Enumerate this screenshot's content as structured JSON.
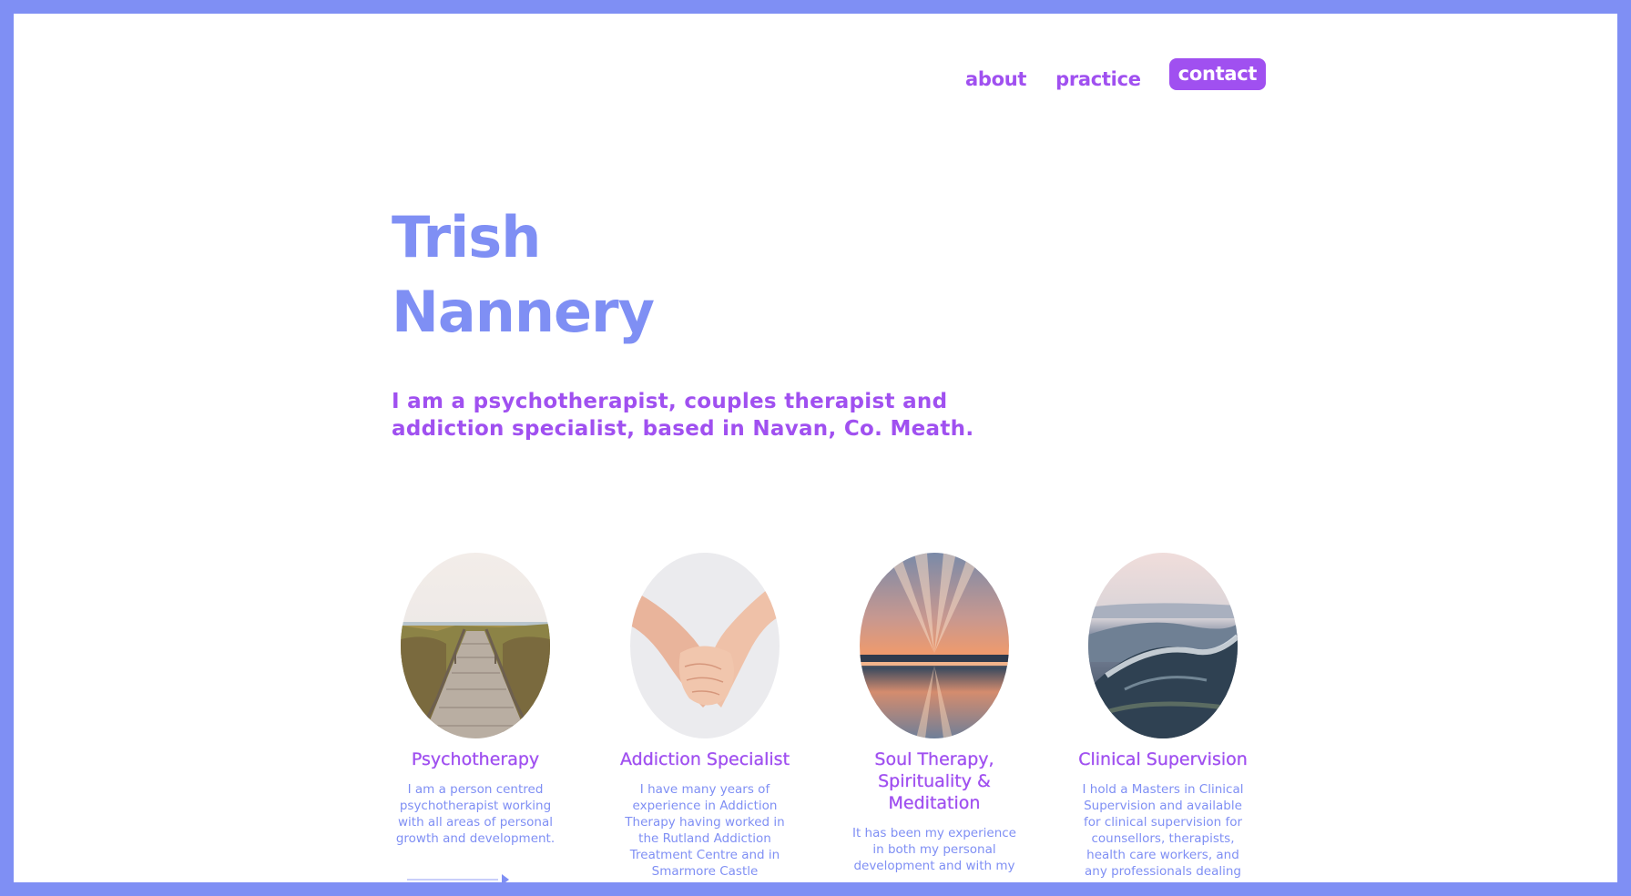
{
  "nav": {
    "about": "about",
    "practice": "practice",
    "contact": "contact"
  },
  "hero": {
    "name_line1": "Trish",
    "name_line2": "Nannery",
    "tagline": "I am a psychotherapist, couples therapist and addiction specialist, based in Navan, Co. Meath."
  },
  "colors": {
    "frame": "#7f8ff4",
    "accent": "#a050f0",
    "title": "#7f8ff4"
  },
  "services": [
    {
      "title": "Psychotherapy",
      "image": "boardwalk-to-beach",
      "desc": "I am a person centred psychotherapist working with all areas of personal growth and development."
    },
    {
      "title": "Addiction Specialist",
      "image": "holding-hands",
      "desc": "I have many years of experience in Addiction Therapy having worked in the Rutland Addiction Treatment Centre and in Smarmore Castle Addiction"
    },
    {
      "title": "Soul Therapy, Spirituality & Meditation",
      "image": "sunset-over-water",
      "desc": "It has been my experience in both my personal development and with my"
    },
    {
      "title": "Clinical Supervision",
      "image": "ocean-wave",
      "desc": "I hold a Masters in Clinical Supervision and available for clinical supervision for counsellors, therapists, health care workers, and any professionals dealing"
    }
  ]
}
